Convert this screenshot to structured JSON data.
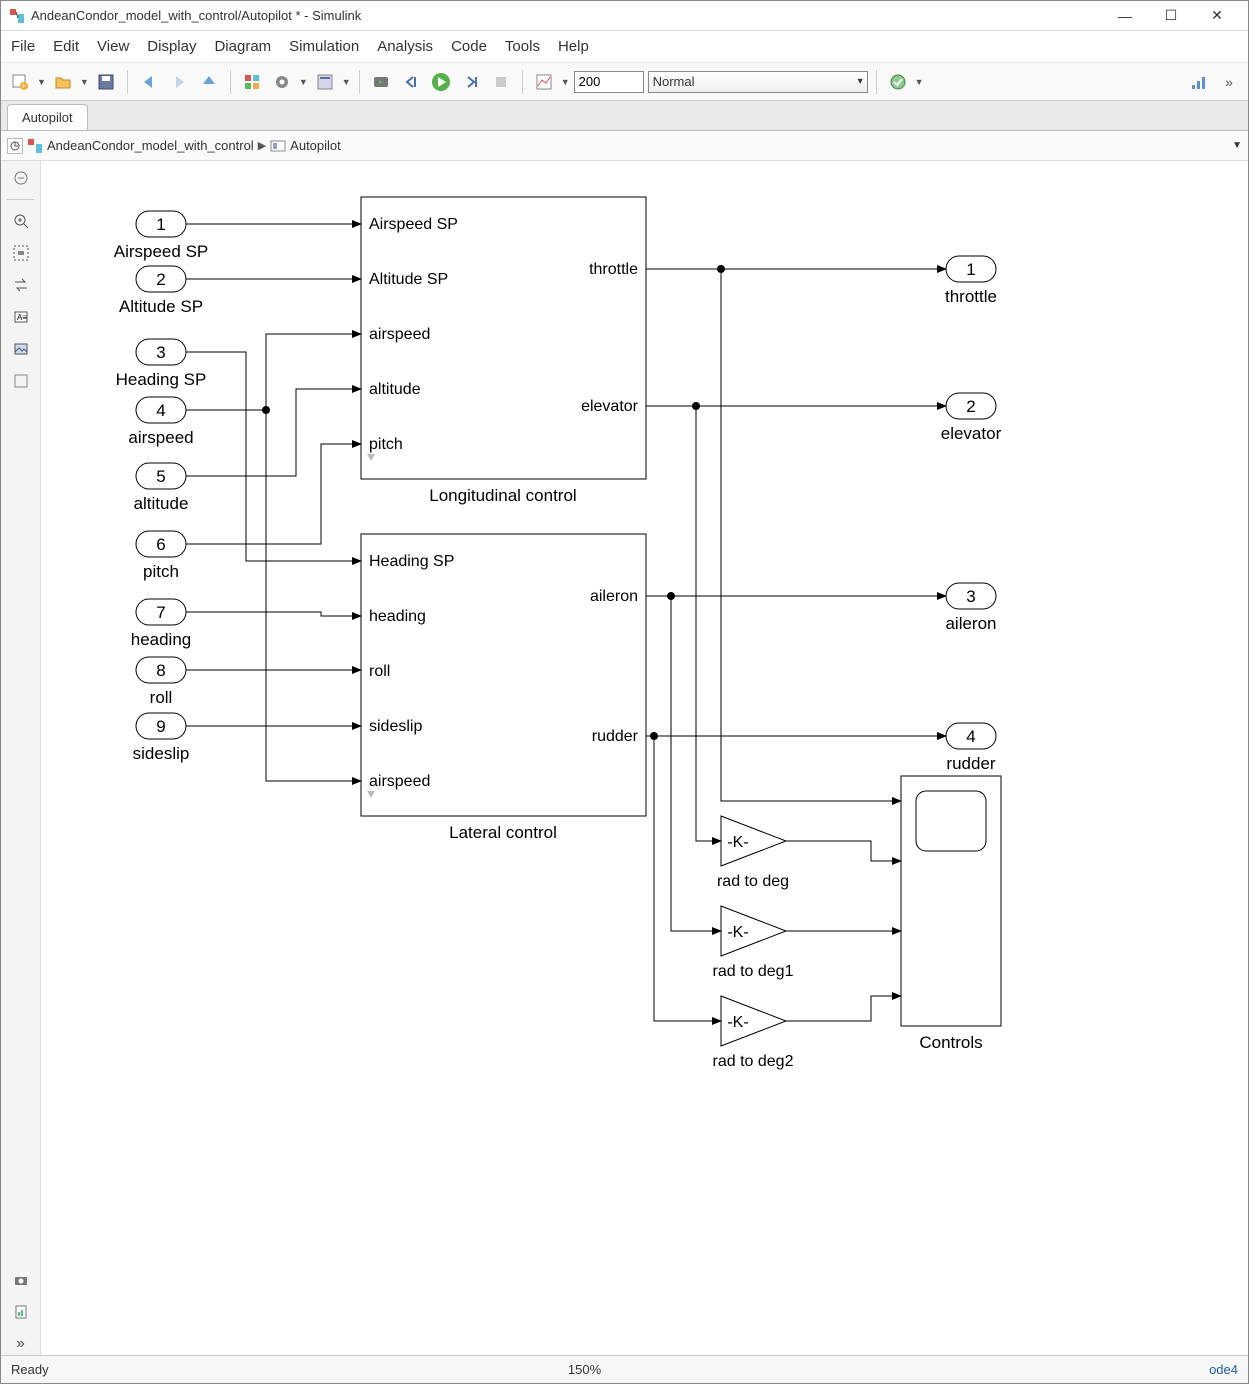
{
  "window": {
    "title": "AndeanCondor_model_with_control/Autopilot * - Simulink"
  },
  "menu": {
    "file": "File",
    "edit": "Edit",
    "view": "View",
    "display": "Display",
    "diagram": "Diagram",
    "simulation": "Simulation",
    "analysis": "Analysis",
    "code": "Code",
    "tools": "Tools",
    "help": "Help"
  },
  "toolbar": {
    "stop_time": "200",
    "mode": "Normal"
  },
  "tab": "Autopilot",
  "breadcrumb": {
    "root": "AndeanCondor_model_with_control",
    "child": "Autopilot"
  },
  "inputs": [
    {
      "num": "1",
      "label": "Airspeed SP"
    },
    {
      "num": "2",
      "label": "Altitude SP"
    },
    {
      "num": "3",
      "label": "Heading SP"
    },
    {
      "num": "4",
      "label": "airspeed"
    },
    {
      "num": "5",
      "label": "altitude"
    },
    {
      "num": "6",
      "label": "pitch"
    },
    {
      "num": "7",
      "label": "heading"
    },
    {
      "num": "8",
      "label": "roll"
    },
    {
      "num": "9",
      "label": "sideslip"
    }
  ],
  "long_block": {
    "title": "Longitudinal control",
    "in_ports": [
      "Airspeed SP",
      "Altitude SP",
      "airspeed",
      "altitude",
      "pitch"
    ],
    "out_ports": [
      "throttle",
      "elevator"
    ]
  },
  "lat_block": {
    "title": "Lateral control",
    "in_ports": [
      "Heading SP",
      "heading",
      "roll",
      "sideslip",
      "airspeed"
    ],
    "out_ports": [
      "aileron",
      "rudder"
    ]
  },
  "gains": [
    {
      "label": "rad to deg",
      "val": "-K-"
    },
    {
      "label": "rad to deg1",
      "val": "-K-"
    },
    {
      "label": "rad to deg2",
      "val": "-K-"
    }
  ],
  "scope": {
    "label": "Controls"
  },
  "outputs": [
    {
      "num": "1",
      "label": "throttle"
    },
    {
      "num": "2",
      "label": "elevator"
    },
    {
      "num": "3",
      "label": "aileron"
    },
    {
      "num": "4",
      "label": "rudder"
    }
  ],
  "status": {
    "ready": "Ready",
    "zoom": "150%",
    "solver": "ode4"
  }
}
